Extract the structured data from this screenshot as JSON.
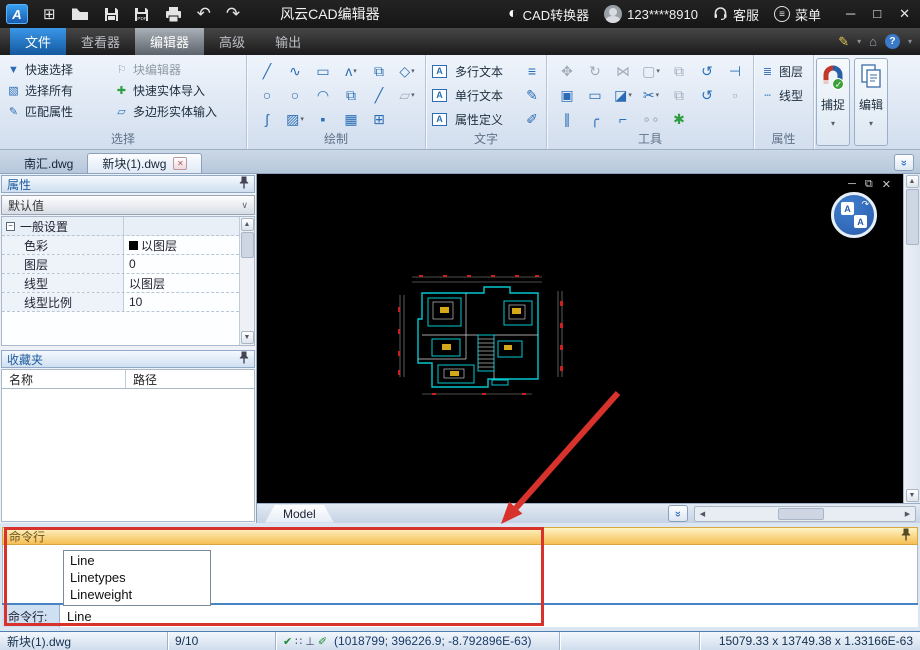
{
  "title_bar": {
    "title": "风云CAD编辑器",
    "cad_converter": "CAD转换器",
    "account": "123****8910",
    "customer_service": "客服",
    "menu": "菜单"
  },
  "menu_tabs": {
    "file": "文件",
    "viewer": "查看器",
    "editor": "编辑器",
    "advanced": "高级",
    "output": "输出"
  },
  "ribbon": {
    "select": {
      "label": "选择",
      "items": [
        "快速选择",
        "块编辑器",
        "选择所有",
        "快速实体导入",
        "匹配属性",
        "多边形实体输入"
      ]
    },
    "draw": {
      "label": "绘制",
      "grid": [
        {
          "n": "line",
          "ch": "╱"
        },
        {
          "n": "sketch",
          "ch": "∿"
        },
        {
          "n": "rectangle",
          "ch": "▭"
        },
        {
          "n": "polyline",
          "ch": "ʌ",
          "dd": true
        },
        {
          "n": "insert-block",
          "ch": "⧉"
        },
        {
          "n": "polygon",
          "ch": "◇",
          "dd": true
        },
        {
          "n": "circle",
          "ch": "○"
        },
        {
          "n": "ellipse",
          "ch": "○"
        },
        {
          "n": "arc",
          "ch": "◠"
        },
        {
          "n": "block",
          "ch": "⧉"
        },
        {
          "n": "construction-line",
          "ch": "╱"
        },
        {
          "n": "region",
          "ch": "▱",
          "dd": true,
          "d": true
        },
        {
          "n": "spline",
          "ch": "ʃ"
        },
        {
          "n": "hatch",
          "ch": "▨",
          "dd": true
        },
        {
          "n": "point",
          "ch": "▪"
        },
        {
          "n": "image",
          "ch": "▦"
        },
        {
          "n": "table",
          "ch": "⊞"
        }
      ]
    },
    "text": {
      "label": "文字",
      "items": [
        "多行文本",
        "单行文本",
        "属性定义"
      ]
    },
    "tools": {
      "label": "工具",
      "grid": [
        {
          "n": "move",
          "ch": "✥",
          "d": true
        },
        {
          "n": "rotate",
          "ch": "↻",
          "d": true
        },
        {
          "n": "mirror",
          "ch": "⋈",
          "d": true
        },
        {
          "n": "stretch",
          "ch": "▢",
          "dd": true,
          "d": true
        },
        {
          "n": "copy",
          "ch": "⧉",
          "d": true
        },
        {
          "n": "copy-with-time",
          "ch": "↺"
        },
        {
          "n": "align",
          "ch": "⊣"
        },
        {
          "n": "array",
          "ch": "▣"
        },
        {
          "n": "rectangle-array",
          "ch": "▭"
        },
        {
          "n": "erase",
          "ch": "◪",
          "dd": true
        },
        {
          "n": "trim",
          "ch": "✂",
          "dd": true
        },
        {
          "n": "group",
          "ch": "⧉",
          "d": true
        },
        {
          "n": "paste-with-time",
          "ch": "↺"
        },
        {
          "n": "scale",
          "ch": "▫",
          "d": true
        },
        {
          "n": "offset",
          "ch": "∥"
        },
        {
          "n": "fillet",
          "ch": "╭"
        },
        {
          "n": "chamfer",
          "ch": "⌐"
        },
        {
          "n": "join",
          "ch": "∘∘",
          "d": true
        },
        {
          "n": "explode",
          "ch": "✱",
          "g": true
        }
      ]
    },
    "props": {
      "label": "属性",
      "layers": "图层",
      "linetype": "线型"
    },
    "snap_button": "捕捉",
    "edit_button": "编辑"
  },
  "document_tabs": {
    "tab1": "南汇.dwg",
    "tab2": "新块(1).dwg"
  },
  "properties_panel": {
    "title": "属性",
    "preset": "默认值",
    "group": "一般设置",
    "rows": [
      {
        "label": "色彩",
        "value": "以图层"
      },
      {
        "label": "图层",
        "value": "0"
      },
      {
        "label": "线型",
        "value": "以图层"
      },
      {
        "label": "线型比例",
        "value": "10"
      }
    ]
  },
  "favorites_panel": {
    "title": "收藏夹",
    "col_name": "名称",
    "col_path": "路径"
  },
  "canvas": {
    "model_tab": "Model"
  },
  "command_panel": {
    "title": "命令行",
    "suggestions": [
      "Line",
      "Linetypes",
      "Lineweight"
    ],
    "prompt": "命令行:",
    "input_value": "Line"
  },
  "status_bar": {
    "filename": "新块(1).dwg",
    "ratio": "9/10",
    "coordinates": "(1018799; 396226.9; -8.792896E-63)",
    "dimensions": "15079.33 x 13749.38 x 1.33166E-63"
  },
  "icons": {
    "new": "⊞",
    "undo": "↶",
    "redo": "↷",
    "converter": "◐",
    "menu_lines": "≡",
    "minimize": "─",
    "maximize": "□",
    "close": "✕",
    "pencil": "✎",
    "home": "⌂",
    "help": "?",
    "quick_select": "▼",
    "block_editor": "⚐",
    "select_all": "▧",
    "entity_import": "✚",
    "match_props": "✎",
    "polygon_entity": "▱",
    "text_a": "A",
    "text_numbering": "≡",
    "text_edit": "✎",
    "attr_edit": "✐",
    "layers": "≣",
    "linetype": "┄",
    "caret": "▾",
    "chevron": "∨",
    "chevrons": "«",
    "canvas_min": "─",
    "canvas_restore": "⧉",
    "canvas_close": "✕",
    "scroll_up": "▲",
    "scroll_down": "▼",
    "scroll_left": "◀",
    "scroll_right": "▶",
    "osnap": "✔",
    "grid_snap": "∷",
    "ortho": "⊥",
    "dyn_input": "✐",
    "group_collapse": "−"
  },
  "colors": {
    "accent_blue": "#2a6db4",
    "header_blue": "#1f5c9e",
    "command_header_orange": "#f6bf54",
    "annotation_red": "#d8322c",
    "canvas_black": "#000000",
    "plan_cyan": "#00c8d0",
    "plan_yellow": "#d4a818",
    "plan_red": "#cc2020"
  }
}
